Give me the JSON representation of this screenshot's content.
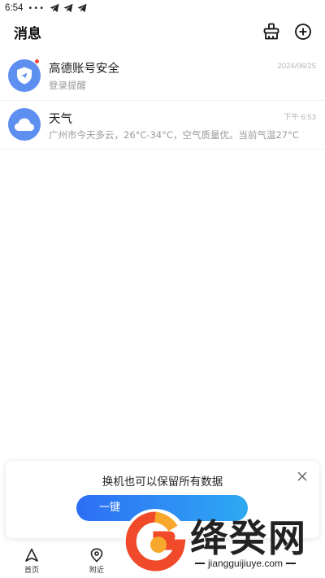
{
  "status_bar": {
    "time": "6:54",
    "dots": "•••"
  },
  "header": {
    "title": "消息"
  },
  "messages": [
    {
      "name": "高德账号安全",
      "subtitle": "登录提醒",
      "time": "2024/06/25",
      "icon": "shield-icon",
      "unread": true
    },
    {
      "name": "天气",
      "subtitle": "广州市今天多云，26°C-34°C，空气质量优。当前气温27°C",
      "time": "下午 6:53",
      "icon": "cloud-icon",
      "unread": false
    }
  ],
  "promo": {
    "title": "换机也可以保留所有数据",
    "button_label": "一键"
  },
  "tabbar": [
    {
      "label": "首页",
      "icon": "navigation-arrow-icon"
    },
    {
      "label": "附近",
      "icon": "location-pin-icon"
    }
  ],
  "watermark": {
    "brand": "绛癸网",
    "url": "jiangguijiuye.com"
  },
  "colors": {
    "accent": "#2e6ef5",
    "avatar": "#5d8ff0",
    "unread_dot": "#f5423b"
  }
}
